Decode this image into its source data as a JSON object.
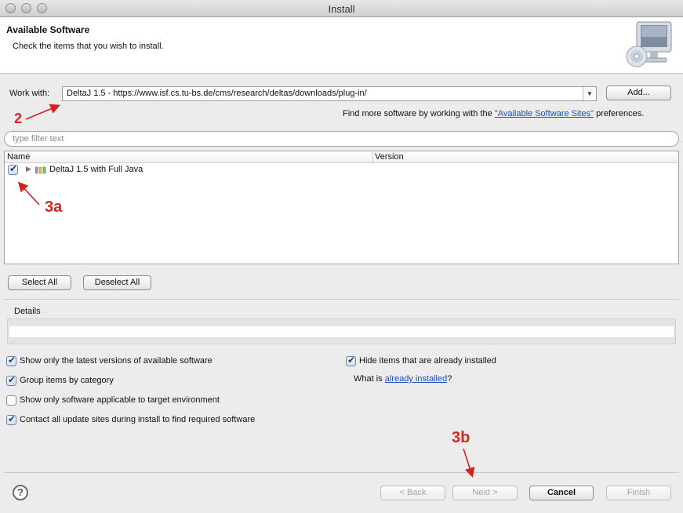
{
  "window": {
    "title": "Install"
  },
  "header": {
    "title": "Available Software",
    "subtitle": "Check the items that you wish to install."
  },
  "work_with": {
    "label": "Work with:",
    "value": "DeltaJ 1.5 - https://www.isf.cs.tu-bs.de/cms/research/deltas/downloads/plug-in/",
    "add_label": "Add..."
  },
  "find_more": {
    "prefix": "Find more software by working with the ",
    "link": "\"Available Software Sites\"",
    "suffix": " preferences."
  },
  "filter": {
    "placeholder": "type filter text"
  },
  "tree": {
    "columns": [
      "Name",
      "Version"
    ],
    "items": [
      {
        "name": "DeltaJ 1.5 with Full Java",
        "version": "",
        "checked": true
      }
    ]
  },
  "buttons": {
    "select_all": "Select All",
    "deselect_all": "Deselect All",
    "back": "< Back",
    "next": "Next >",
    "cancel": "Cancel",
    "finish": "Finish"
  },
  "details": {
    "label": "Details"
  },
  "options": {
    "latest_versions": {
      "label": "Show only the latest versions of available software",
      "checked": true
    },
    "group_by_category": {
      "label": "Group items by category",
      "checked": true
    },
    "target_env": {
      "label": "Show only software applicable to target environment",
      "checked": false
    },
    "contact_sites": {
      "label": "Contact all update sites during install to find required software",
      "checked": true
    },
    "hide_installed": {
      "label": "Hide items that are already installed",
      "checked": true
    }
  },
  "already_installed": {
    "prefix": "What is ",
    "link": "already installed",
    "suffix": "?"
  },
  "annotations": {
    "a2": "2",
    "a3a": "3a",
    "a3b": "3b",
    "color": "#d22222"
  },
  "icons": {
    "help": "question-mark-icon",
    "monitor": "monitor-cd-icon",
    "feature": "feature-group-icon"
  }
}
